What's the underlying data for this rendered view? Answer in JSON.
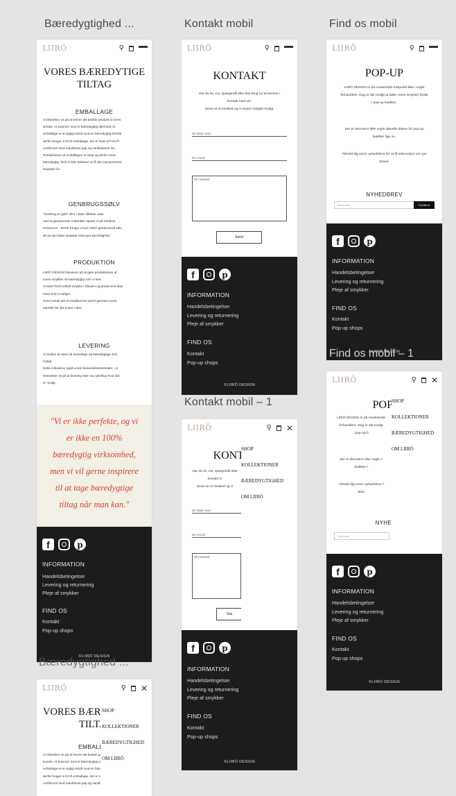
{
  "artboard_labels": {
    "baeredygtighed": "Bæredygtighed ...",
    "kontakt": "Kontakt mobil",
    "findos": "Find os mobil",
    "findos1": "Find os mobil – 1",
    "kontakt1": "Kontakt mobil – 1",
    "baeredygtighed1": "Bæredygtighed ..."
  },
  "header": {
    "logo": "LIIRÖ"
  },
  "menu": {
    "items": [
      "SHOP",
      "KOLLEKTIONER",
      "BÆREDYGTIGHED",
      "OM LIIRÖ"
    ]
  },
  "baeredygtighed": {
    "title_line1": "VORES BÆREDYTIGE",
    "title_line2": "TILTAG",
    "sections": [
      {
        "heading": "EMBALLAGE",
        "lines": [
          "Vi tilstræber os på at levere det bedste produkt til vores",
          "kunder. At kommer med et bæredygtigt alternativ til",
          "emballage er et vigtigt skridt mod en bæredygtig fremtid -",
          "derfor bruger vi ECO-emballage, der er lavet af FSC®-",
          "certificeret med naturfarvet pap og vandbaseret lim.",
          "Produktionen af emballagen er lokal og derfor mere",
          "bæredygtig, fordi vi ikke behøver at få den transporteret",
          "langveje fra."
        ]
      },
      {
        "heading": "GENBRUGSSØLV",
        "lines": [
          "\"Genbrug er guld\" eller i dette tilfælde, sølv.",
          "Ved at genanvende materialer sparer vi på Klodens",
          "ressourcer - derfor bruger vi kun 100% genanvendt sølv,",
          "så du kan købe smykker med god samvittighed."
        ]
      },
      {
        "heading": "PRODUKTION",
        "lines": [
          "LIIRÖ DESIGN fokuserer på at gøre produktionen af",
          "vores smykker så bæredygtig som vi kan.",
          "Vi laver hvert enkelt smykke i hånden og producerer ikke",
          "mere end vi sælger.",
          "Hvert enkelt del af smykket har været gennem vores",
          "hænder før det ender i dine."
        ]
      },
      {
        "heading": "LEVERING",
        "lines": [
          "Vi ønsker at være så ansvarlige og bæredygtige som",
          "muligt.",
          "Dette inkluderer også vores forsendelsesmetoder - vi",
          "bestræber os på at levering sker via cykelbud hvor det",
          "er muligt."
        ]
      }
    ],
    "quote_lines": [
      "\"Vi er ikke perfekte, og vi",
      "er ikke en 100%",
      "bæredygtig virksomhed,",
      "men vi vil gerne inspirere",
      "til at tage bæredygtige",
      "tiltag når man kan.\""
    ]
  },
  "kontakt": {
    "title": "KONTAKT",
    "intro": [
      "Har du ris, ros, spørgsmål eller blot brug for at komme i",
      "kontakt med os?",
      "Send os en besked og vi svarer hurtigst muligt."
    ],
    "name_placeholder": "Dit fulde navn",
    "email_placeholder": "Din email",
    "message_placeholder": "Din besked",
    "send_label": "Send",
    "title_partial": "KONT",
    "intro_partial": [
      "Har du ris, ros, spørgsmål eller",
      "kontakt m",
      "Send os en besked og vi"
    ],
    "send_partial": "Sen"
  },
  "findos": {
    "title": "POP-UP",
    "intro": [
      "LIIRÖ DESIGN er på nuværende tidspunkt ikke i nogle",
      "forhandlere. Dog er det muligt at købe vores smykker fysisk",
      "i pop-up butikker."
    ],
    "note": [
      "Der er desværre ikke nogle aktuelle datoer for pop-up",
      "butikker lige nu."
    ],
    "signup": [
      "Tilmeld dig vores nyhedsbrev for at få information om nye",
      "datoer."
    ],
    "newsletter_heading": "NYHEDBREV",
    "email_placeholder": "Din email",
    "signup_button": "TILMELD",
    "title_partial": "POP",
    "intro_partial": [
      "LIIRÖ DESIGN er på nuværende",
      "forhandlere. Dog er det muligt",
      "i pop-up b"
    ],
    "note_partial": [
      "Der er desværre ikke nogle a",
      "butikker l"
    ],
    "signup_partial": [
      "Tilmeld dig vores nyhedsbrev f",
      "dato"
    ],
    "newsletter_partial": "NYHE"
  },
  "footer": {
    "info_heading": "INFORMATION",
    "info_links": [
      "Handelsbetingelser",
      "Levering og returnering",
      "Pleje af smykker"
    ],
    "findos_heading": "FIND OS",
    "findos_links": [
      "Kontakt",
      "Pop-up shops"
    ],
    "copyright": "©LIIRÖ DESIGN"
  }
}
